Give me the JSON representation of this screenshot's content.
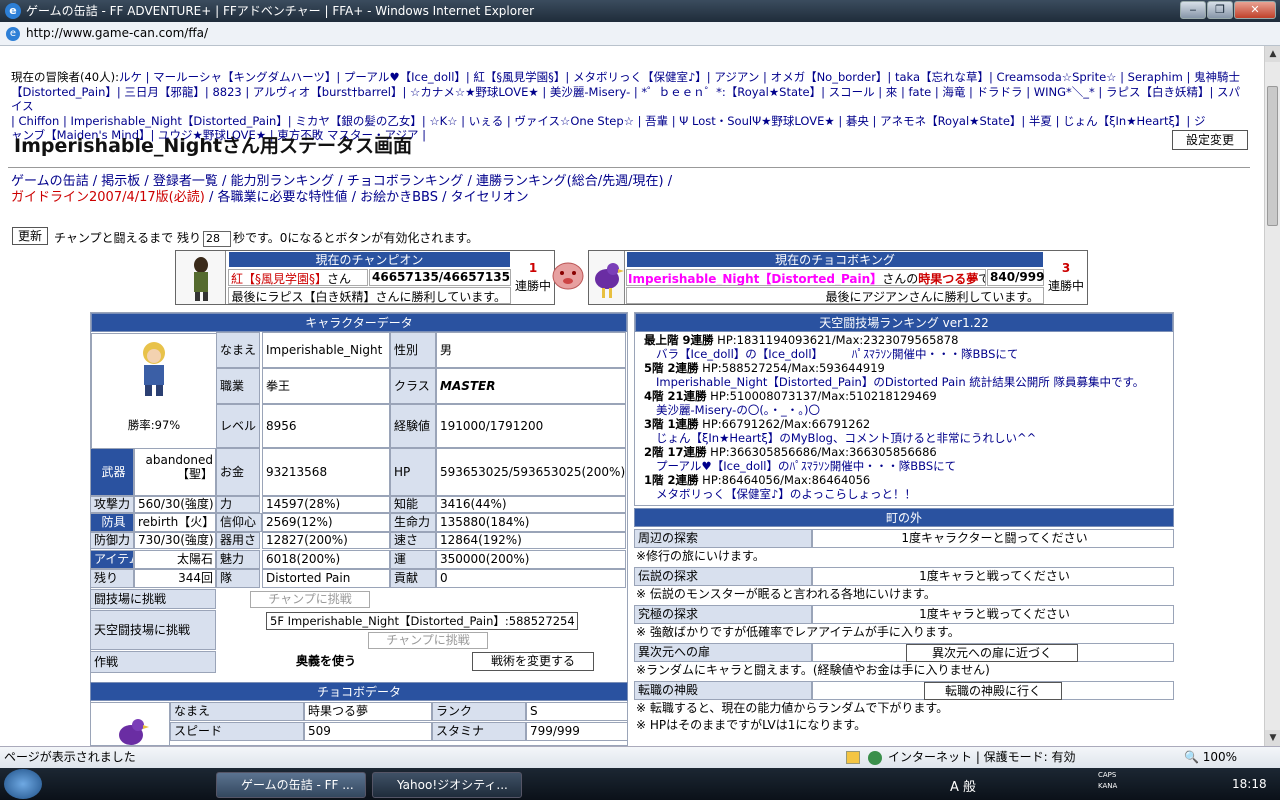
{
  "window": {
    "title": "ゲームの缶詰 - FF ADVENTURE+ | FFアドベンチャー | FFA+ - Windows Internet Explorer",
    "url": "http://www.game-can.com/ffa/"
  },
  "adventurers": {
    "prefix": "現在の冒険者(40人):",
    "line1": "ルケ | マールーシャ【キングダムハーツ】| プーアル♥【Ice_doll】| 紅【§風見学園§】| メタボリっく【保健室♪】| アジアン | オメガ【No_border】| taka【忘れな草】| Creamsoda☆Sprite☆ | Seraphim | 鬼神騎士",
    "line2": "【Distorted_Pain】| 三日月【邪龍】| 8823 | アルヴィオ【burst†barrel】| ☆カナメ☆★野球LOVE★ | 美沙麗-Misery- | *゜ｂｅｅｎ゜*:【Royal★State】| スコール | 來 | fate | 海竜 | ドラドラ | WING*＼_* | ラピス【白き妖精】| スパイス",
    "line3": "| Chiffon | Imperishable_Night【Distorted_Pain】| ミカヤ【銀の髪の乙女】| ☆K☆ | いぇる | ヴァイス☆One Step☆ | 吾輩 | Ψ Lost・SoulΨ★野球LOVE★ | 碁央 | アネモネ【Royal★State】| 半夏 | じょん【ξIn★Heartξ】| ジ",
    "line4": "ャンブ【Maiden's Mind】| ユウジ★野球LOVE★ | 東方不敗 マスター・アジア |"
  },
  "page": {
    "title": "Imperishable_Nightさん用ステータス画面",
    "settings_btn": "設定変更"
  },
  "nav": {
    "line1": "ゲームの缶詰 / 掲示板 / 登録者一覧 / 能力別ランキング / チョコボランキング / 連勝ランキング(総合/先週/現在) /",
    "line2_red": "ガイドライン2007/4/17版(必読)",
    "line2_rest": " / 各職業に必要な特性値 / お絵かきBBS / タイセリオン"
  },
  "countdown": {
    "update_btn": "更新",
    "before": "チャンプと闘えるまで 残り",
    "value": "28",
    "after": "秒です。0になるとボタンが有効化されます。"
  },
  "champion": {
    "header": "現在のチャンピオン",
    "name": "紅【§風見学園§】",
    "suffix": "さん",
    "hp": "46657135/46657135",
    "wins_num": "1",
    "wins_label": "連勝中",
    "last": "最後にラピス【白き妖精】さんに勝利しています。"
  },
  "chocobo_king": {
    "header": "現在のチョコボキング",
    "name": "Imperishable_Night【Distorted_Pain】",
    "mid": "さんの",
    "chocobo": "時果つる夢",
    "end": "です",
    "hp": "840/999",
    "wins_num": "3",
    "wins_label": "連勝中",
    "last": "最後にアジアンさんに勝利しています。"
  },
  "char": {
    "header": "キャラクターデータ",
    "winrate": "勝率:97%",
    "name_l": "なまえ",
    "name": "Imperishable_Night",
    "sex_l": "性別",
    "sex": "男",
    "job_l": "職業",
    "job": "拳王",
    "class_l": "クラス",
    "class": "MASTER",
    "lv_l": "レベル",
    "lv": "8956",
    "exp_l": "経験値",
    "exp": "191000/1791200",
    "weapon_l": "武器",
    "weapon": "abandoned【聖】",
    "gold_l": "お金",
    "gold": "93213568",
    "hp_l": "HP",
    "hp": "593653025/593653025(200%)",
    "atk_l": "攻撃力",
    "atk": "560/30(強度)",
    "str_l": "力",
    "str": "14597(28%)",
    "int_l": "知能",
    "int": "3416(44%)",
    "armor_l": "防具",
    "armor": "rebirth【火】",
    "faith_l": "信仰心",
    "faith": "2569(12%)",
    "vit_l": "生命力",
    "vit": "135880(184%)",
    "def_l": "防御力",
    "def": "730/30(強度)",
    "dex_l": "器用さ",
    "dex": "12827(200%)",
    "spd_l": "速さ",
    "spd": "12864(192%)",
    "item_l": "アイテム",
    "item": "太陽石",
    "cha_l": "魅力",
    "cha": "6018(200%)",
    "luck_l": "運",
    "luck": "350000(200%)",
    "rem_l": "残り",
    "rem": "344回",
    "party_l": "隊",
    "party": "Distorted Pain",
    "contrib_l": "貢献",
    "contrib": "0",
    "arena_l": "闘技場に挑戦",
    "arena_btn": "チャンプに挑戦",
    "sky_l": "天空闘技場に挑戦",
    "sky_sel": "5F Imperishable_Night【Distorted_Pain】:588527254",
    "sky_btn": "チャンプに挑戦",
    "tactic_l": "作戦",
    "tactic": "奥義を使う",
    "tactic_btn": "戦術を変更する"
  },
  "chocobo": {
    "header": "チョコボデータ",
    "name_l": "なまえ",
    "name": "時果つる夢",
    "rank_l": "ランク",
    "rank": "S",
    "speed_l": "スピード",
    "speed": "509",
    "stam_l": "スタミナ",
    "stam": "799/999"
  },
  "ranking": {
    "header": "天空闘技場ランキング ver1.22",
    "r1a": "最上階 9連勝",
    "r1b": " HP:1831194093621/Max:2323079565878",
    "r1c": "バラ【Ice_doll】の【Ice_doll】　　　ﾊﾟｽﾏﾗｿﾝ開催中・・・隊BBSにて",
    "r2a": "5階 2連勝",
    "r2b": " HP:588527254/Max:593644919",
    "r2c": "Imperishable_Night【Distorted_Pain】のDistorted Pain 統計結果公開所 隊員募集中です。",
    "r3a": "4階 21連勝",
    "r3b": " HP:510008073137/Max:510218129469",
    "r3c": "美沙麗-Misery-の〇(。・_・。)〇",
    "r4a": "3階 1連勝",
    "r4b": " HP:66791262/Max:66791262",
    "r4c": "じょん【ξIn★Heartξ】のMyBlog、コメント頂けると非常にうれしい^^",
    "r5a": "2階 17連勝",
    "r5b": " HP:366305856686/Max:366305856686",
    "r5c": "プーアル♥【Ice_doll】のﾊﾟｽﾏﾗｿﾝ開催中・・・隊BBSにて",
    "r6a": "1階 2連勝",
    "r6b": " HP:86464056/Max:86464056",
    "r6c": "メタボリっく【保健室♪】のよっこらしょっと！！"
  },
  "town": {
    "header": "町の外",
    "t1l": "周辺の探索",
    "t1v": "1度キャラクターと闘ってください",
    "t1d": "※修行の旅にいけます。",
    "t2l": "伝説の探求",
    "t2v": "1度キャラと戦ってください",
    "t2d": "※ 伝説のモンスターが眠ると言われる各地にいけます。",
    "t3l": "究極の探求",
    "t3v": "1度キャラと戦ってください",
    "t3d": "※ 強敵ばかりですが低確率でレアアイテムが手に入ります。",
    "t4l": "異次元への扉",
    "t4b": "異次元への扉に近づく",
    "t4d": "※ランダムにキャラと闘えます。(経験値やお金は手に入りません)",
    "t5l": "転職の神殿",
    "t5b": "転職の神殿に行く",
    "t5d1": "※ 転職すると、現在の能力値からランダムで下がります。",
    "t5d2": "※ HPはそのままですがLVは1になります。"
  },
  "status": {
    "left": "ページが表示されました",
    "zone": "インターネット | 保護モード: 有効",
    "zoom": "100%"
  },
  "taskbar": {
    "task1": "ゲームの缶詰 - FF ...",
    "task2": "Yahoo!ジオシティ...",
    "clock": "18:18",
    "ime": "A 般",
    "caps": "CAPS",
    "kana": "KANA"
  }
}
